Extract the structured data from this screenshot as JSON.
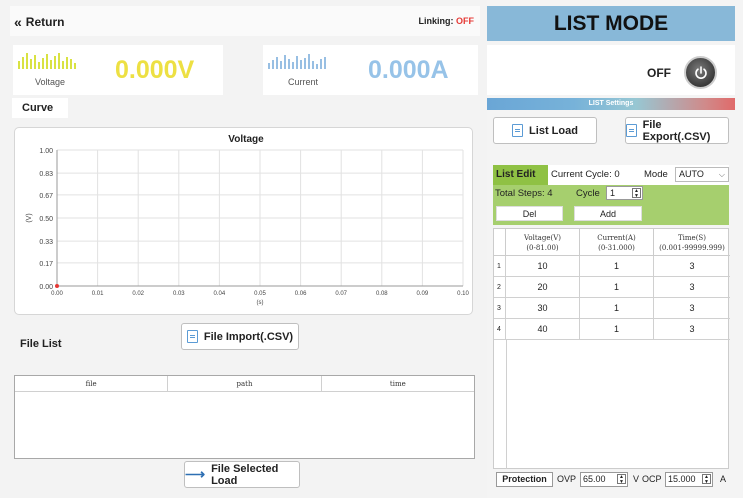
{
  "topbar": {
    "return_label": "Return",
    "return_icon": "double-chevron-left-icon",
    "linking_label": "Linking:",
    "linking_status": "OFF",
    "linking_status_color": "#e53935"
  },
  "meters": {
    "voltage": {
      "label": "Voltage",
      "value": "0.000V",
      "color": "#ede043"
    },
    "current": {
      "label": "Current",
      "value": "0.000A",
      "color": "#97c3e8"
    }
  },
  "curve": {
    "section_title": "Curve"
  },
  "chart_data": {
    "type": "line",
    "title": "Voltage",
    "xlabel": "(s)",
    "ylabel": "(V)",
    "xlim": [
      0.0,
      0.1
    ],
    "ylim": [
      0.0,
      1.0
    ],
    "x_ticks": [
      "0.00",
      "0.01",
      "0.02",
      "0.03",
      "0.04",
      "0.05",
      "0.06",
      "0.07",
      "0.08",
      "0.09",
      "0.10"
    ],
    "y_ticks": [
      "1.00",
      "0.83",
      "0.67",
      "0.50",
      "0.33",
      "0.17",
      "0.00"
    ],
    "series": [
      {
        "values": [
          {
            "x": 0.0,
            "y": 0.0
          }
        ],
        "color": "#e53935"
      }
    ],
    "grid": true,
    "legend": "none"
  },
  "file_import": {
    "label": "File Import(.CSV)",
    "icon": "document-icon"
  },
  "file_list": {
    "section_title": "File List",
    "columns": [
      "file",
      "path",
      "time"
    ],
    "rows": []
  },
  "file_load": {
    "label": "File  Selected Load",
    "icon": "arrow-right-icon"
  },
  "right": {
    "title": "LIST MODE",
    "power_state": "OFF",
    "power_icon": "power-icon",
    "list_settings_label": "LIST Settings",
    "list_load_label": "List Load",
    "file_export_label": "File Export(.CSV)",
    "list_edit_label": "List Edit",
    "current_cycle_text": "Current Cycle: 0",
    "mode_label": "Mode",
    "mode_value": "AUTO",
    "total_steps_text": "Total Steps: 4",
    "cycle_label": "Cycle",
    "cycle_value": "1",
    "del_label": "Del",
    "add_label": "Add",
    "table": {
      "headers": [
        {
          "line1": "Voltage(V)",
          "line2": "(0-81.00)"
        },
        {
          "line1": "Current(A)",
          "line2": "(0-31.000)"
        },
        {
          "line1": "Time(S)",
          "line2": "(0.001-99999.999)"
        }
      ],
      "rows": [
        {
          "index": "1",
          "voltage": "10",
          "current": "1",
          "time": "3"
        },
        {
          "index": "2",
          "voltage": "20",
          "current": "1",
          "time": "3"
        },
        {
          "index": "3",
          "voltage": "30",
          "current": "1",
          "time": "3"
        },
        {
          "index": "4",
          "voltage": "40",
          "current": "1",
          "time": "3"
        }
      ]
    },
    "protection": {
      "label": "Protection",
      "ovp_label": "OVP",
      "ovp_value": "65.00",
      "v_unit": "V",
      "ocp_label": "OCP",
      "ocp_value": "15.000",
      "a_unit": "A"
    }
  }
}
